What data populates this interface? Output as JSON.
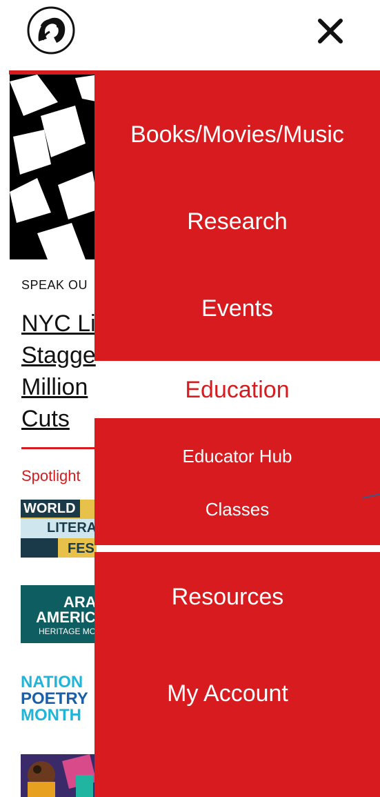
{
  "header": {
    "logo_icon": "lion-logo-icon",
    "close_icon": "close-icon"
  },
  "background": {
    "eyebrow": "SPEAK OU",
    "headline_lines": [
      "NYC Li",
      "Stagge",
      "Million",
      "Cuts"
    ],
    "spotlight_label": "Spotlight",
    "thumbs": [
      {
        "lines": [
          "WORLD",
          "LITERA",
          "FEST"
        ]
      },
      {
        "lines": [
          "ARAB",
          "AMERIC",
          "HERITAGE MO"
        ]
      },
      {
        "lines": [
          "NATION",
          "POETRY",
          "MONTH"
        ]
      }
    ]
  },
  "menu": {
    "items": [
      {
        "label": "Books/Movies/Music"
      },
      {
        "label": "Research"
      },
      {
        "label": "Events"
      }
    ],
    "education": {
      "label": "Education",
      "subitems": [
        {
          "label": "Educator Hub"
        },
        {
          "label": "Classes"
        }
      ]
    },
    "bottom_items": [
      {
        "label": "Resources"
      },
      {
        "label": "My Account"
      }
    ]
  },
  "colors": {
    "accent_red": "#d71b1e",
    "teal": "#0e5d61",
    "text": "#111111"
  }
}
